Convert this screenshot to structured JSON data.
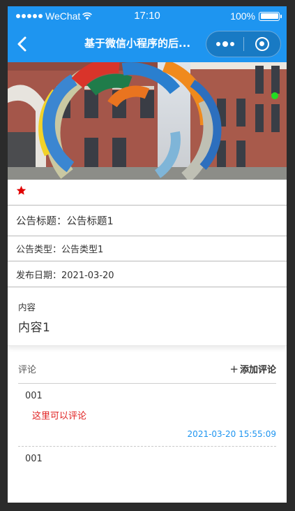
{
  "status_bar": {
    "carrier": "WeChat",
    "time": "17:10",
    "battery": "100%",
    "signal_icon": "signal-dots-icon",
    "wifi_icon": "wifi-icon",
    "battery_icon": "battery-icon"
  },
  "nav": {
    "title": "基于微信小程序的后...",
    "back_icon": "chevron-left-icon",
    "more_icon": "more-dots-icon",
    "close_icon": "target-circle-icon",
    "accent_color": "#1e95f0"
  },
  "banner": {
    "image": "building-sculpture-photo"
  },
  "detail": {
    "star_icon": "star-icon",
    "star_color": "#e00000",
    "title_row": "公告标题：公告标题1",
    "type_row": "公告类型：公告类型1",
    "date_row": "发布日期：2021-03-20",
    "content_label": "内容",
    "content_value": "内容1"
  },
  "comments": {
    "title": "评论",
    "add_label": "添加评论",
    "add_icon": "plus-icon",
    "items": [
      {
        "user": "001",
        "text": "这里可以评论",
        "time": "2021-03-20 15:55:09"
      },
      {
        "user": "001"
      }
    ]
  }
}
